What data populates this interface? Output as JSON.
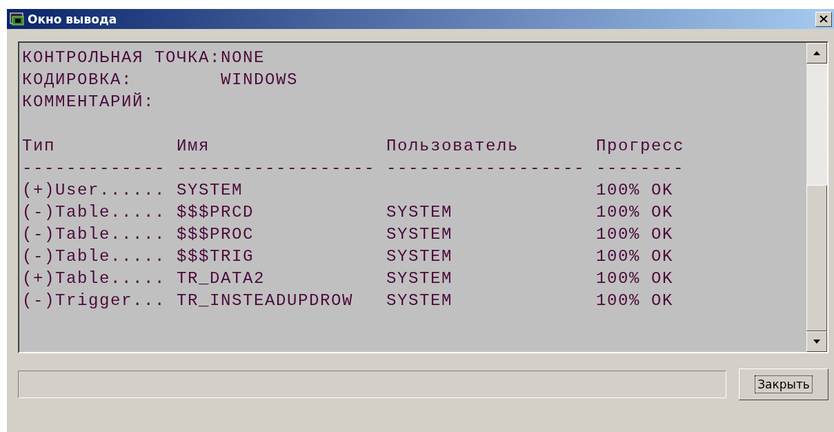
{
  "window": {
    "title": "Окно вывода"
  },
  "output": {
    "lines": [
      "КОНТРОЛЬНАЯ ТОЧКА:NONE",
      "КОДИРОВКА:        WINDOWS",
      "КОММЕНТАРИЙ:"
    ],
    "columns": [
      {
        "heading": "Тип",
        "rule": "-------------"
      },
      {
        "heading": "Имя",
        "rule": "------------------"
      },
      {
        "heading": "Пользователь",
        "rule": "------------------"
      },
      {
        "heading": "Прогресс",
        "rule": "--------"
      }
    ],
    "rows": [
      [
        "(+)User......",
        "SYSTEM",
        "",
        "100% OK"
      ],
      [
        "(-)Table.....",
        "$$$PRCD",
        "SYSTEM",
        "100% OK"
      ],
      [
        "(-)Table.....",
        "$$$PROC",
        "SYSTEM",
        "100% OK"
      ],
      [
        "(-)Table.....",
        "$$$TRIG",
        "SYSTEM",
        "100% OK"
      ],
      [
        "(+)Table.....",
        "TR_DATA2",
        "SYSTEM",
        "100% OK"
      ],
      [
        "(-)Trigger...",
        "TR_INSTEADUPDROW",
        "SYSTEM",
        "100% OK"
      ]
    ]
  },
  "close_button": {
    "label": "Закрыть"
  }
}
